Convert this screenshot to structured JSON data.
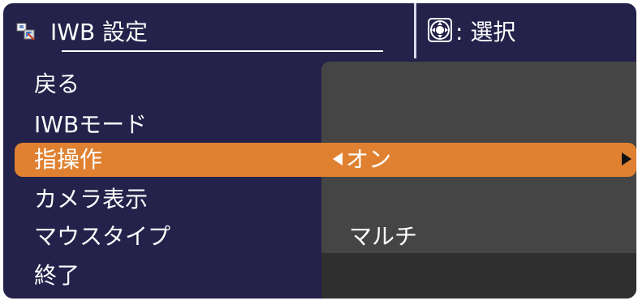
{
  "header": {
    "title": "IWB 設定",
    "title_icon": "iwb-settings-icon",
    "select_icon": "dpad-icon",
    "select_label": ": 選択"
  },
  "menu": {
    "items": [
      {
        "label": "戻る"
      },
      {
        "label": "IWBモード"
      },
      {
        "label": "指操作",
        "value": "オン",
        "selected": true
      },
      {
        "label": "カメラ表示"
      },
      {
        "label": "マウスタイプ",
        "value": "マルチ"
      },
      {
        "label": "終了"
      }
    ]
  },
  "colors": {
    "background": "#24214a",
    "highlight": "#e08132",
    "value_panel": "#454545",
    "text": "#ffffff"
  }
}
